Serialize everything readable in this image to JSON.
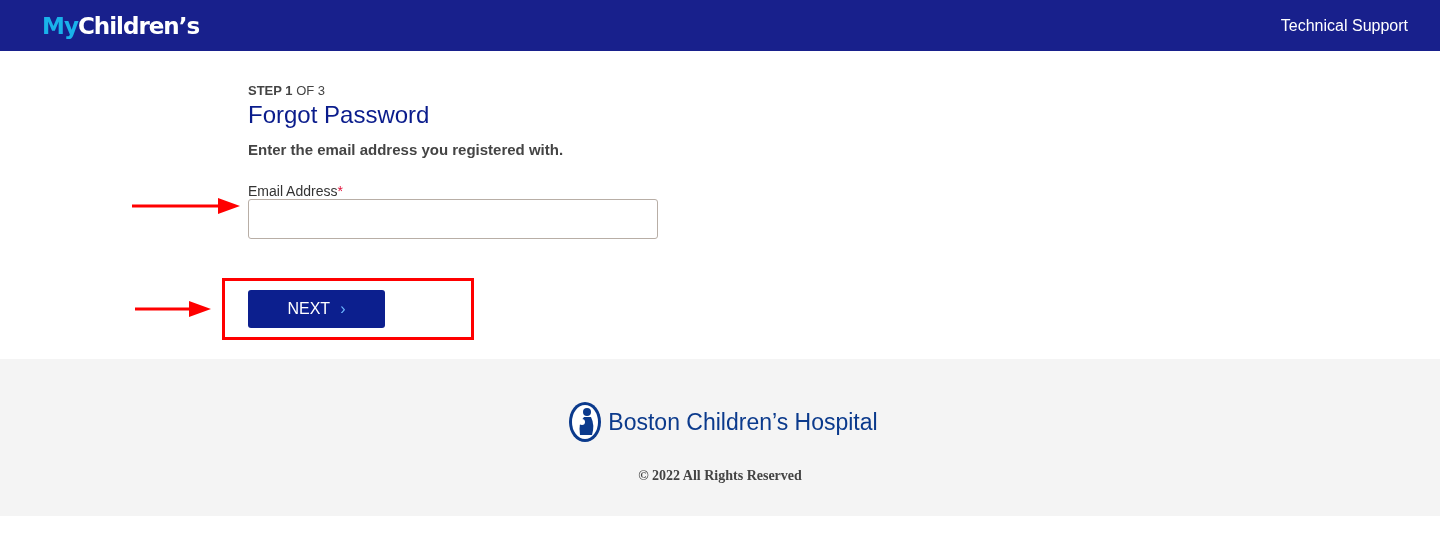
{
  "header": {
    "logo": {
      "prefix": "My",
      "name": "Children’s"
    },
    "link": "Technical Support"
  },
  "form": {
    "step": "**STEP 1** OF 3",
    "title": "Forgot Password",
    "instruction": "Enter the email address you registered with.",
    "field": {
      "label": "Email Address",
      "required_mark": "*",
      "arrow_marker": true
    },
    "button": {
      "label": "NEXT",
      "chevron": "›",
      "arrow_marker": true,
      "highlight_box": true
    }
  },
  "footer": {
    "brand": "Boston Children’s Hospital",
    "copyright": "© 2022 All Rights Reserved"
  }
}
